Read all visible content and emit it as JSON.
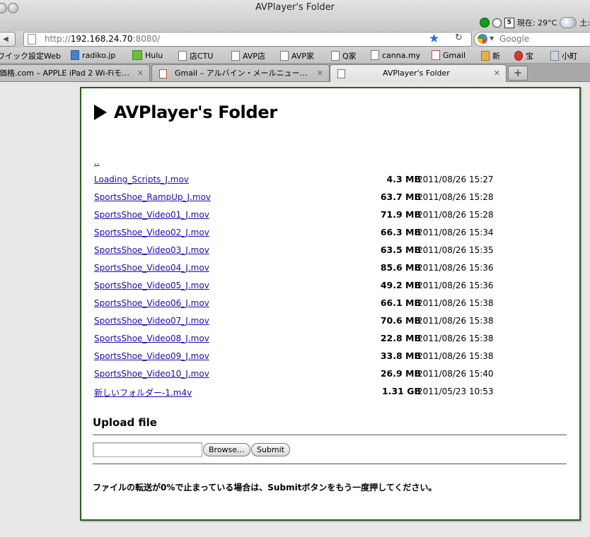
{
  "window": {
    "title": "AVPlayer's Folder",
    "menu_extras": {
      "calendar_day": "5",
      "weather_text": "現在: 29°C",
      "day_partial": "土:"
    }
  },
  "toolbar": {
    "back_icon": "◀",
    "url_scheme": "http://",
    "url_host": "192.168.24.70",
    "url_port": ":8080/",
    "star_icon": "★",
    "reload_icon": "↻",
    "search_caret": "▼",
    "search_placeholder": "Google"
  },
  "bookmarks": [
    {
      "label": "ワイック設定Web",
      "icon": "none"
    },
    {
      "label": "radiko.jp",
      "icon": "blue"
    },
    {
      "label": "Hulu",
      "icon": "green"
    },
    {
      "label": "店CTU",
      "icon": "page"
    },
    {
      "label": "AVP店",
      "icon": "page"
    },
    {
      "label": "AVP家",
      "icon": "page"
    },
    {
      "label": "Q家",
      "icon": "page"
    },
    {
      "label": "canna.my",
      "icon": "page"
    },
    {
      "label": "Gmail",
      "icon": "gmail"
    },
    {
      "label": "新",
      "icon": "gold"
    },
    {
      "label": "宝",
      "icon": "red"
    },
    {
      "label": "小町",
      "icon": "grey"
    }
  ],
  "tabs": [
    {
      "label": "価格.com – APPLE iPad 2 Wi-Fiモ…",
      "active": false
    },
    {
      "label": "Gmail – アルバイン・メールニュー…",
      "active": false
    },
    {
      "label": "AVPlayer's Folder",
      "active": true
    }
  ],
  "tab_close": "✕",
  "new_tab": "+",
  "page": {
    "heading": "AVPlayer's Folder",
    "parent_link": "..",
    "files": [
      {
        "name": "Loading_Scripts_J.mov",
        "size": "4.3 MB",
        "date": "2011/08/26 15:27"
      },
      {
        "name": "SportsShoe_RampUp_J.mov",
        "size": "63.7 MB",
        "date": "2011/08/26 15:28"
      },
      {
        "name": "SportsShoe_Video01_J.mov",
        "size": "71.9 MB",
        "date": "2011/08/26 15:28"
      },
      {
        "name": "SportsShoe_Video02_J.mov",
        "size": "66.3 MB",
        "date": "2011/08/26 15:34"
      },
      {
        "name": "SportsShoe_Video03_J.mov",
        "size": "63.5 MB",
        "date": "2011/08/26 15:35"
      },
      {
        "name": "SportsShoe_Video04_J.mov",
        "size": "85.6 MB",
        "date": "2011/08/26 15:36"
      },
      {
        "name": "SportsShoe_Video05_J.mov",
        "size": "49.2 MB",
        "date": "2011/08/26 15:36"
      },
      {
        "name": "SportsShoe_Video06_J.mov",
        "size": "66.1 MB",
        "date": "2011/08/26 15:38"
      },
      {
        "name": "SportsShoe_Video07_J.mov",
        "size": "70.6 MB",
        "date": "2011/08/26 15:38"
      },
      {
        "name": "SportsShoe_Video08_J.mov",
        "size": "22.8 MB",
        "date": "2011/08/26 15:38"
      },
      {
        "name": "SportsShoe_Video09_J.mov",
        "size": "33.8 MB",
        "date": "2011/08/26 15:38"
      },
      {
        "name": "SportsShoe_Video10_J.mov",
        "size": "26.9 MB",
        "date": "2011/08/26 15:40"
      },
      {
        "name": "新しいフォルダー-1.m4v",
        "size": "1.31 GB",
        "date": "2011/05/23 10:53"
      }
    ],
    "upload": {
      "title": "Upload file",
      "browse_label": "Browse...",
      "submit_label": "Submit",
      "notice": "ファイルの転送が0%で止まっている場合は、Submitボタンをもう一度押してください。"
    }
  },
  "colors": {
    "link": "#1a0dab",
    "frame_border": "#2c5f20",
    "star": "#2d6fd6"
  }
}
